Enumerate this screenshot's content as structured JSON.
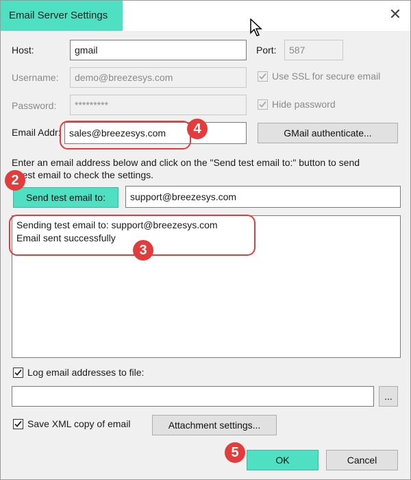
{
  "window": {
    "title": "Email Server Settings",
    "close_icon": "✕"
  },
  "fields": {
    "host_label": "Host:",
    "host_value": "gmail",
    "port_label": "Port:",
    "port_value": "587",
    "username_label": "Username:",
    "username_value": "demo@breezesys.com",
    "ssl_label": "Use SSL for secure email",
    "password_label": "Password:",
    "password_value": "*********",
    "hide_password_label": "Hide password",
    "email_addr_label": "Email Addr:",
    "email_addr_value": "sales@breezesys.com",
    "gmail_auth_label": "GMail authenticate..."
  },
  "instructions": {
    "line1": "Enter an email address below and click on the \"Send test email to:\" button to send",
    "line2": "a test email to check the settings."
  },
  "test": {
    "send_button_label": "Send test email to:",
    "recipient_value": "support@breezesys.com",
    "log_lines": [
      "Sending test email to: support@breezesys.com",
      "Email sent successfully"
    ]
  },
  "options": {
    "log_to_file_label": "Log email addresses to file:",
    "log_file_path": "",
    "browse_label": "...",
    "save_xml_label": "Save XML copy of email",
    "attachment_settings_label": "Attachment settings..."
  },
  "footer": {
    "ok_label": "OK",
    "cancel_label": "Cancel"
  },
  "annotations": {
    "b2": "2",
    "b3": "3",
    "b4": "4",
    "b5": "5"
  },
  "colors": {
    "highlight": "#4fe0c4",
    "annotation": "#e23c3c"
  }
}
